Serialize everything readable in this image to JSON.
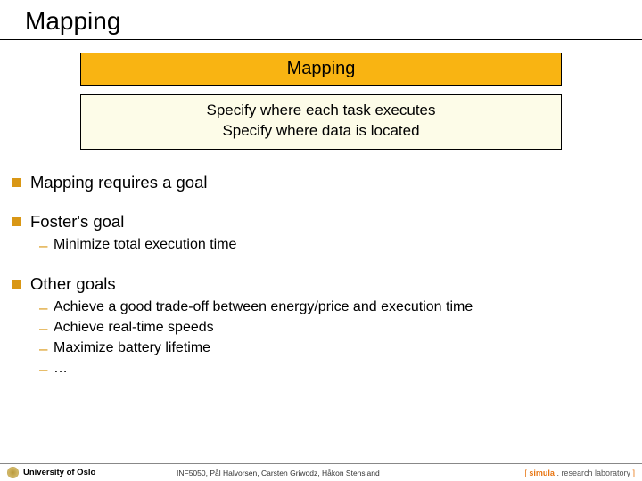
{
  "title": "Mapping",
  "banner": {
    "label": "Mapping"
  },
  "spec": {
    "line1": "Specify where each task executes",
    "line2": "Specify where data is located"
  },
  "bullets": {
    "b1": {
      "text": "Mapping requires a goal"
    },
    "b2": {
      "text": "Foster's goal",
      "subs": {
        "s1": "Minimize total execution time"
      }
    },
    "b3": {
      "text": "Other goals",
      "subs": {
        "s1": "Achieve a good trade-off between energy/price and execution time",
        "s2": "Achieve real-time speeds",
        "s3": "Maximize battery lifetime",
        "s4": "…"
      }
    }
  },
  "footer": {
    "uio": "University of Oslo",
    "center": "INF5050, Pål Halvorsen, Carsten Griwodz, Håkon Stensland",
    "right": {
      "a": "[ ",
      "b": "simula",
      "c": " . research laboratory",
      "d": " ]"
    }
  }
}
